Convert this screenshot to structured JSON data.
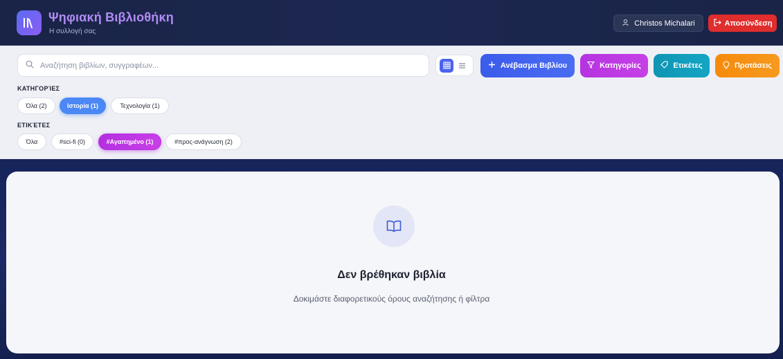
{
  "header": {
    "app_title": "Ψηφιακή Βιβλιοθήκη",
    "app_subtitle": "Η συλλογή σας",
    "logo_icon": "library-icon",
    "user_name": "Christos Michalari",
    "user_icon": "user-icon",
    "logout_label": "Αποσύνδεση",
    "logout_icon": "logout-icon"
  },
  "toolbar": {
    "search_placeholder": "Αναζήτηση βιβλίων, συγγραφέων...",
    "search_icon": "search-icon",
    "view_modes": [
      "grid",
      "list"
    ],
    "active_view": "grid",
    "upload_label": "Ανέβασμα Βιβλίου",
    "categories_label": "Κατηγορίες",
    "tags_label": "Ετικέτες",
    "suggestions_label": "Προτάσεις"
  },
  "filters": {
    "categories_heading": "ΚΑΤΗΓΟΡΊΕΣ",
    "categories": [
      {
        "label": "Όλα (2)",
        "active": false
      },
      {
        "label": "Ιστορία (1)",
        "active": true
      },
      {
        "label": "Τεχνολογία (1)",
        "active": false
      }
    ],
    "tags_heading": "ΕΤΙΚΈΤΕΣ",
    "tags": [
      {
        "label": "Όλα",
        "active": false
      },
      {
        "label": "#sci-fi (0)",
        "active": false
      },
      {
        "label": "#Αγαπημένο (1)",
        "active": true
      },
      {
        "label": "#προς-ανάγνωση (2)",
        "active": false
      }
    ]
  },
  "empty_state": {
    "icon": "open-book-icon",
    "title": "Δεν βρέθηκαν βιβλία",
    "subtitle": "Δοκιμάστε διαφορετικούς όρους αναζήτησης ή φίλτρα"
  },
  "colors": {
    "header_bg": "#1a2447",
    "accent_blue": "#4b63ee",
    "logout_red": "#e02d2d",
    "categories_purple": "#b534e0",
    "tags_teal": "#0e95b3",
    "suggestions_orange": "#f58a0c"
  }
}
